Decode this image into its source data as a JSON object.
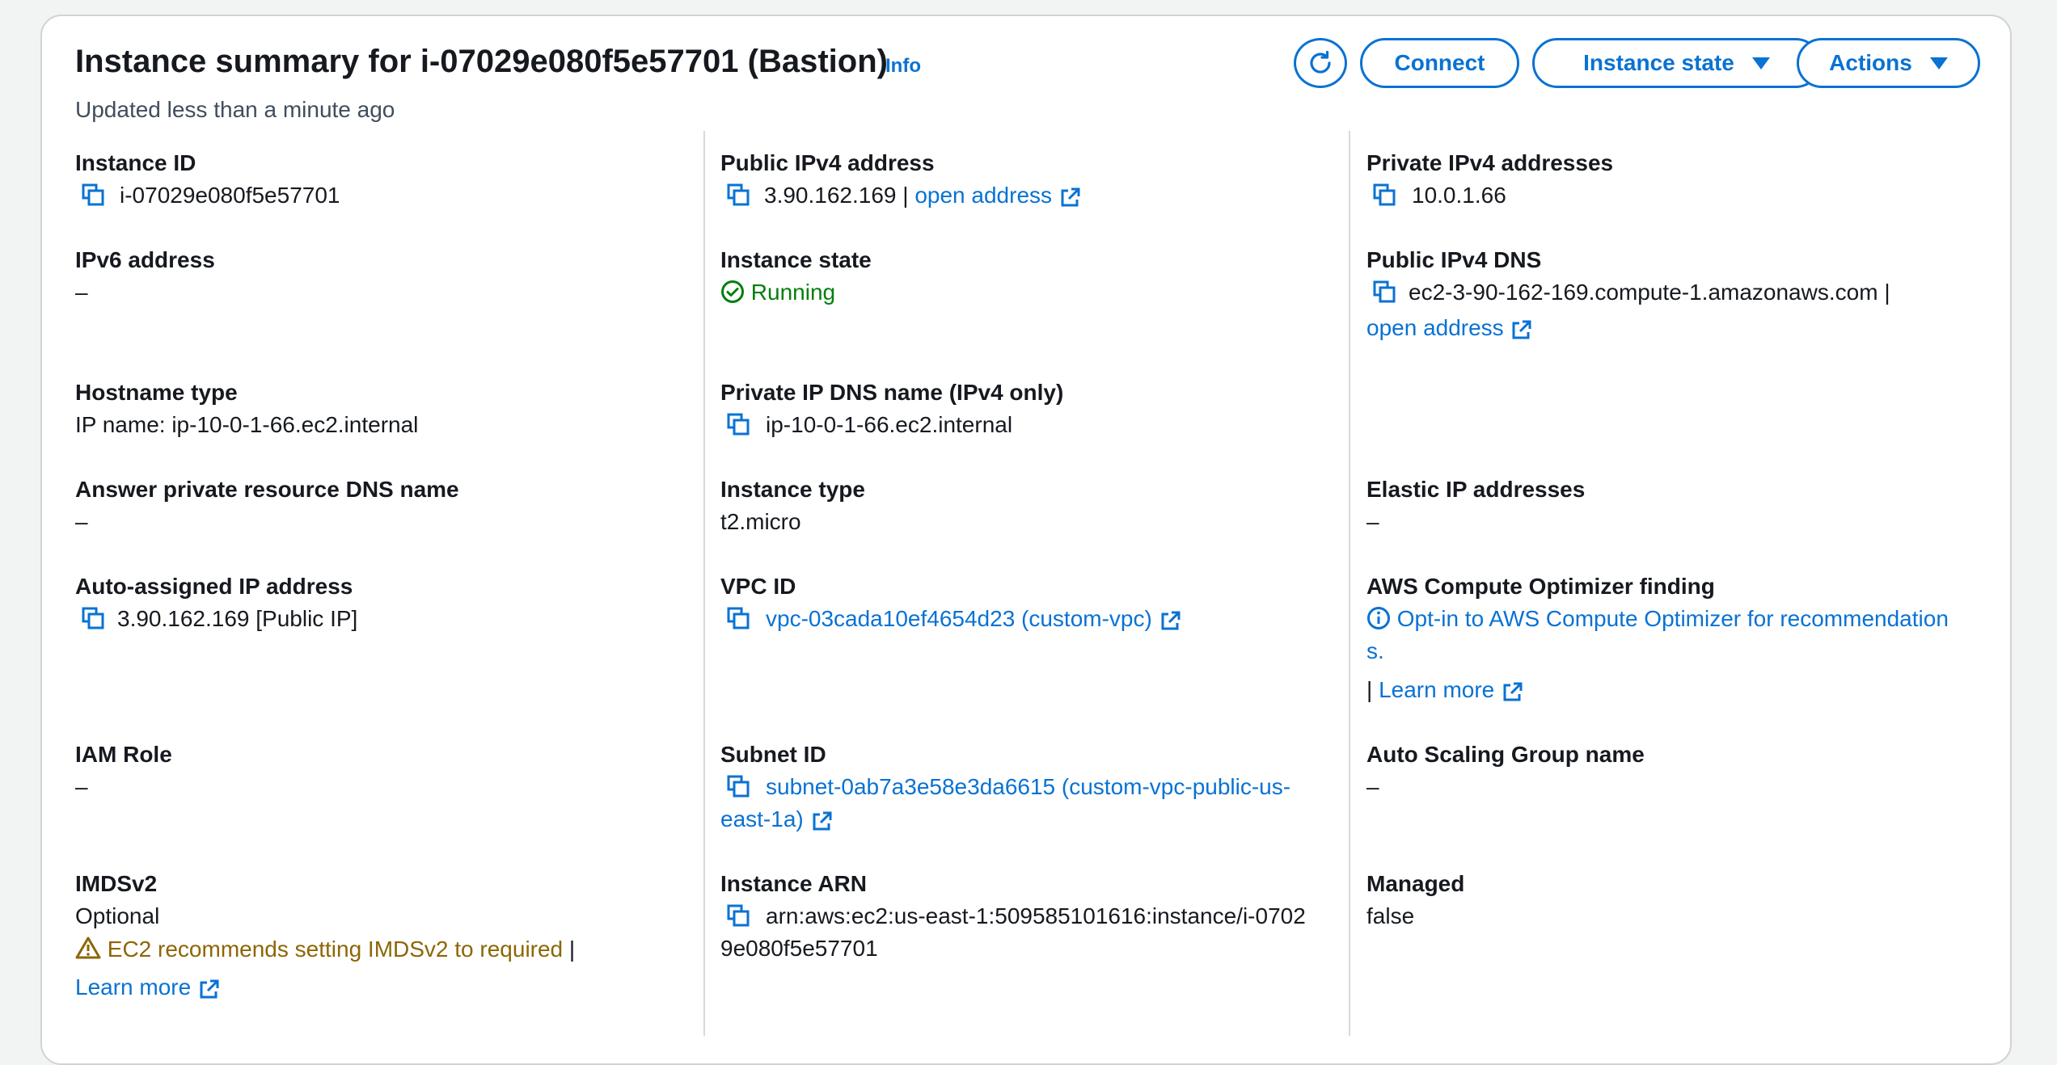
{
  "header": {
    "title": "Instance summary for i-07029e080f5e57701 (Bastion)",
    "info": "Info",
    "subtitle": "Updated less than a minute ago",
    "buttons": {
      "connect": "Connect",
      "instance_state": "Instance state",
      "actions": "Actions"
    }
  },
  "col1": {
    "instance_id": {
      "label": "Instance ID",
      "value": "i-07029e080f5e57701"
    },
    "ipv6": {
      "label": "IPv6 address",
      "value": "–"
    },
    "hostname_type": {
      "label": "Hostname type",
      "value": "IP name: ip-10-0-1-66.ec2.internal"
    },
    "answer_dns": {
      "label": "Answer private resource DNS name",
      "value": "–"
    },
    "auto_ip": {
      "label": "Auto-assigned IP address",
      "value": "3.90.162.169 [Public IP]"
    },
    "iam_role": {
      "label": "IAM Role",
      "value": "–"
    },
    "imdsv2": {
      "label": "IMDSv2",
      "value": "Optional",
      "warning": "EC2 recommends setting IMDSv2 to required",
      "separator": "|",
      "learn_more": "Learn more"
    }
  },
  "col2": {
    "public_ipv4": {
      "label": "Public IPv4 address",
      "value": "3.90.162.169",
      "separator": "|",
      "link": "open address"
    },
    "instance_state": {
      "label": "Instance state",
      "value": "Running"
    },
    "private_dns": {
      "label": "Private IP DNS name (IPv4 only)",
      "value": "ip-10-0-1-66.ec2.internal"
    },
    "instance_type": {
      "label": "Instance type",
      "value": "t2.micro"
    },
    "vpc_id": {
      "label": "VPC ID",
      "value": "vpc-03cada10ef4654d23 (custom-vpc)"
    },
    "subnet_id": {
      "label": "Subnet ID",
      "line1": "subnet-0ab7a3e58e3da6615 (custom-vpc-public-us-",
      "line2": "east-1a)"
    },
    "instance_arn": {
      "label": "Instance ARN",
      "line1": "arn:aws:ec2:us-east-1:509585101616:instance/i-0702",
      "line2": "9e080f5e57701"
    }
  },
  "col3": {
    "private_ipv4": {
      "label": "Private IPv4 addresses",
      "value": "10.0.1.66"
    },
    "public_dns": {
      "label": "Public IPv4 DNS",
      "value": "ec2-3-90-162-169.compute-1.amazonaws.com",
      "separator": "|",
      "link": "open address"
    },
    "elastic_ip": {
      "label": "Elastic IP addresses",
      "value": "–"
    },
    "optimizer": {
      "label": "AWS Compute Optimizer finding",
      "line1": "Opt-in to AWS Compute Optimizer for recommendation",
      "line2": "s.",
      "separator": "|",
      "learn_more": "Learn more"
    },
    "asg": {
      "label": "Auto Scaling Group name",
      "value": "–"
    },
    "managed": {
      "label": "Managed",
      "value": "false"
    }
  },
  "colors": {
    "link": "#0972d3",
    "success": "#037f0c",
    "warning": "#8d6605",
    "text": "#16191f"
  }
}
